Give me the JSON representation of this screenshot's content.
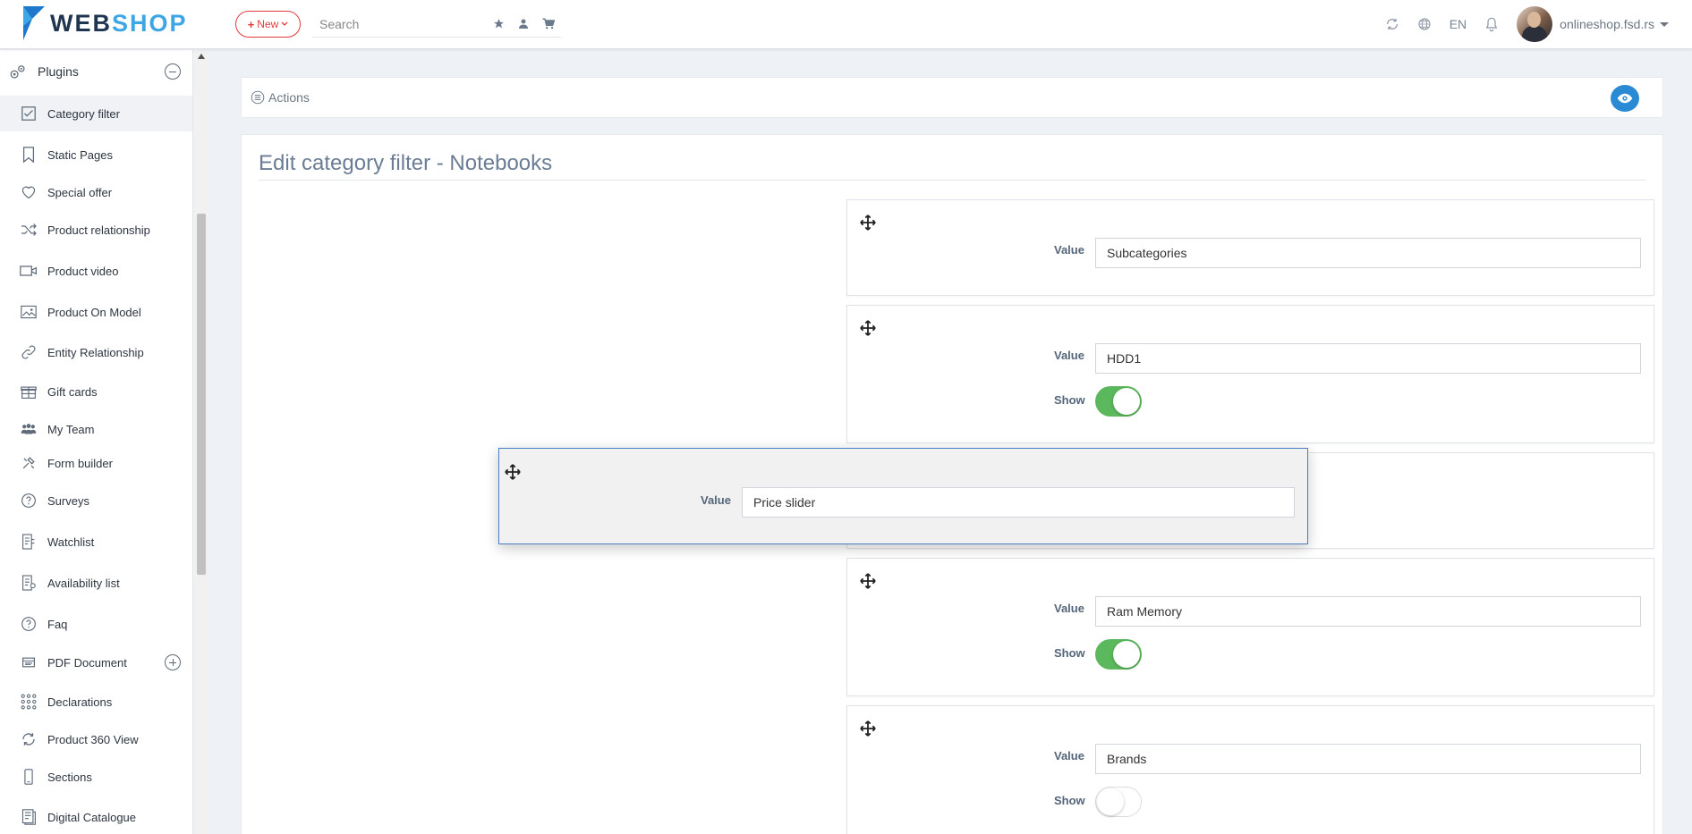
{
  "header": {
    "logo_web": "WEB",
    "logo_shop": "SHOP",
    "new_button": "New",
    "search_placeholder": "Search",
    "language": "EN",
    "user": "onlineshop.fsd.rs"
  },
  "sidebar": {
    "header_label": "Plugins",
    "items": [
      {
        "label": "Category filter",
        "icon": "checklist-icon"
      },
      {
        "label": "Static Pages",
        "icon": "bookmark-icon"
      },
      {
        "label": "Special offer",
        "icon": "heart-icon"
      },
      {
        "label": "Product relationship",
        "icon": "shuffle-icon"
      },
      {
        "label": "Product video",
        "icon": "video-icon"
      },
      {
        "label": "Product On Model",
        "icon": "image-icon"
      },
      {
        "label": "Entity Relationship",
        "icon": "link-icon"
      },
      {
        "label": "Gift cards",
        "icon": "gift-icon"
      },
      {
        "label": "My Team",
        "icon": "team-icon"
      },
      {
        "label": "Form builder",
        "icon": "tools-icon"
      },
      {
        "label": "Surveys",
        "icon": "question-circle-icon"
      },
      {
        "label": "Watchlist",
        "icon": "watchlist-icon"
      },
      {
        "label": "Availability list",
        "icon": "availability-icon"
      },
      {
        "label": "Faq",
        "icon": "question-circle-icon"
      },
      {
        "label": "PDF Document",
        "icon": "pdf-icon"
      },
      {
        "label": "Declarations",
        "icon": "grid-dots-icon"
      },
      {
        "label": "Product 360 View",
        "icon": "rotate-icon"
      },
      {
        "label": "Sections",
        "icon": "mobile-icon"
      },
      {
        "label": "Digital Catalogue",
        "icon": "catalogue-icon"
      }
    ]
  },
  "main": {
    "actions_label": "Actions",
    "page_title": "Edit category filter - Notebooks",
    "value_label": "Value",
    "show_label": "Show",
    "filters": [
      {
        "value": "Subcategories"
      },
      {
        "value": "HDD1",
        "show": true
      },
      {
        "value": "Price slider"
      },
      {
        "value": "Ram Memory",
        "show": true
      },
      {
        "value": "Brands",
        "show": false
      }
    ]
  },
  "colors": {
    "accent_blue": "#2a8bd4",
    "toggle_on": "#5cb85c",
    "new_button_red": "#e03a3a",
    "title_color": "#6b7d95"
  }
}
